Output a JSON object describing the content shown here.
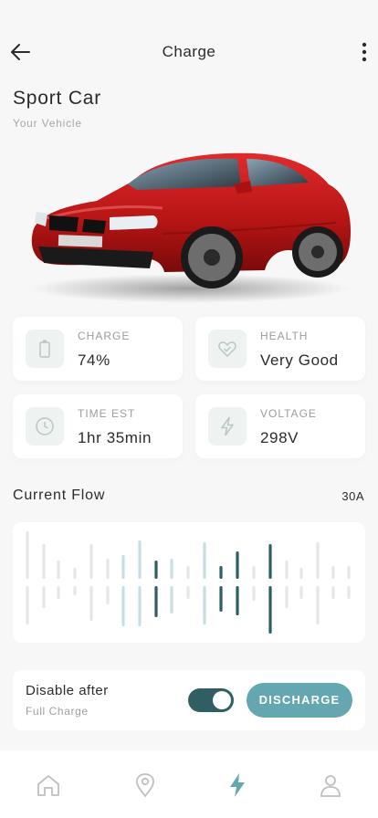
{
  "header": {
    "title": "Charge"
  },
  "vehicle": {
    "name": "Sport Car",
    "subtitle": "Your Vehicle"
  },
  "stats": [
    {
      "label": "CHARGE",
      "value": "74%",
      "icon": "battery-icon"
    },
    {
      "label": "HEALTH",
      "value": "Very Good",
      "icon": "heart-check-icon"
    },
    {
      "label": "TIME EST",
      "value": "1hr 35min",
      "icon": "clock-icon"
    },
    {
      "label": "VOLTAGE",
      "value": "298V",
      "icon": "bolt-outline-icon"
    }
  ],
  "current_flow": {
    "title": "Current Flow",
    "value": "30A"
  },
  "disable_after": {
    "label": "Disable after",
    "sublabel": "Full Charge",
    "toggle_on": true,
    "button_label": "DISCHARGE"
  },
  "nav": {
    "items": [
      {
        "name": "home",
        "icon": "home-icon",
        "active": false
      },
      {
        "name": "location",
        "icon": "location-pin-icon",
        "active": false
      },
      {
        "name": "charge",
        "icon": "lightning-icon",
        "active": true
      },
      {
        "name": "profile",
        "icon": "person-icon",
        "active": false
      }
    ]
  },
  "colors": {
    "accent": "#64a7b1",
    "dark_teal": "#2f5e63",
    "light_teal": "#c7dfe2",
    "bar_gray": "#e6e6e6",
    "car_red": "#c41a1a"
  }
}
